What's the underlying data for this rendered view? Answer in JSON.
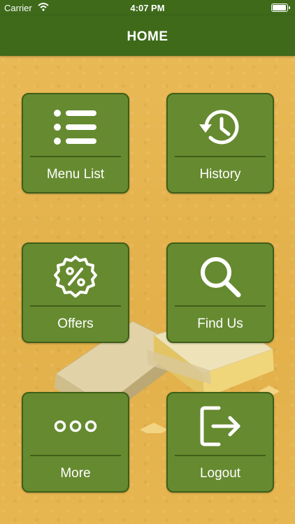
{
  "status_bar": {
    "carrier": "Carrier",
    "time": "4:07 PM",
    "icons": [
      "wifi-icon",
      "battery-icon"
    ]
  },
  "nav": {
    "title": "HOME"
  },
  "colors": {
    "navbar": "#3E6A1A",
    "tile": "#668A30",
    "tile_border": "#3E5E18",
    "background": "#E4B24C"
  },
  "tiles": [
    {
      "label": "Menu List",
      "icon": "list-icon"
    },
    {
      "label": "History",
      "icon": "history-icon"
    },
    {
      "label": "Offers",
      "icon": "percent-badge-icon"
    },
    {
      "label": "Find Us",
      "icon": "search-icon"
    },
    {
      "label": "More",
      "icon": "more-dots-icon"
    },
    {
      "label": "Logout",
      "icon": "logout-icon"
    }
  ]
}
